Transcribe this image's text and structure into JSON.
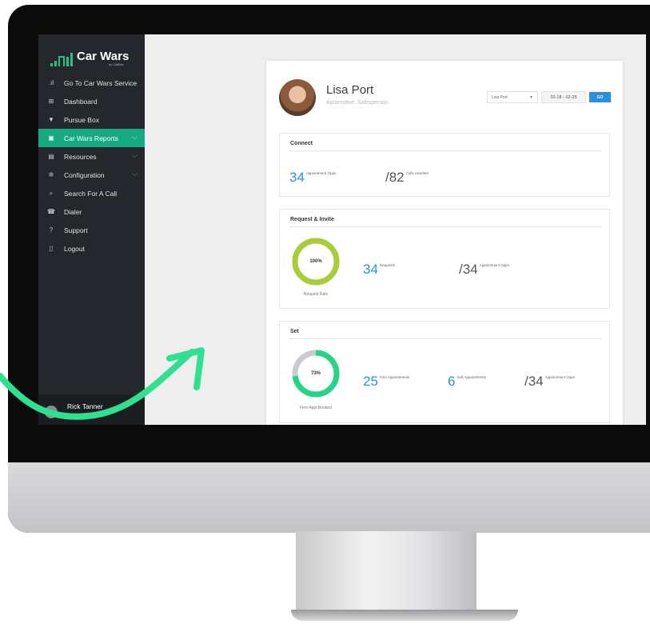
{
  "sidebar": {
    "brand_name": "Car Wars",
    "brand_sub": "by CallBox",
    "items": [
      {
        "label": "Go To Car Wars Service",
        "icon": "signal-bars-icon"
      },
      {
        "label": "Dashboard",
        "icon": "grid-icon"
      },
      {
        "label": "Pursue Box",
        "icon": "box-icon"
      },
      {
        "label": "Car Wars Reports",
        "icon": "report-icon",
        "active": true,
        "chevron": true
      },
      {
        "label": "Resources",
        "icon": "book-icon",
        "chevron": true
      },
      {
        "label": "Configuration",
        "icon": "gear-icon",
        "chevron": true
      },
      {
        "label": "Search For A Call",
        "icon": "search-icon"
      },
      {
        "label": "Dialer",
        "icon": "phone-icon"
      },
      {
        "label": "Support",
        "icon": "question-icon"
      },
      {
        "label": "Logout",
        "icon": "logout-icon"
      }
    ],
    "user_name": "Rick Tanner"
  },
  "header": {
    "name": "Lisa Port",
    "role": "Automotive: Salesperson",
    "select_value": "Lisa Port",
    "date_range": "02-18 - 02-25",
    "go_label": "GO"
  },
  "connect": {
    "title": "Connect",
    "appointment_opps": "34",
    "appointment_opps_label": "Appointment Opps",
    "calls_handled": "/82",
    "calls_handled_label": "Calls Handled"
  },
  "request": {
    "title": "Request & Invite",
    "rate_pct": "100%",
    "rate_value": 100,
    "rate_caption": "Request Rate",
    "requests": "34",
    "requests_label": "Requests",
    "appointment_opps": "/34",
    "appointment_opps_label": "Appointment Opps"
  },
  "set": {
    "title": "Set",
    "booked_pct": "73%",
    "booked_value": 73,
    "booked_caption": "Firm Appt Booked",
    "firm": "25",
    "firm_label": "Firm Appointments",
    "soft": "6",
    "soft_label": "Soft Appointments",
    "appointment_opps": "/34",
    "appointment_opps_label": "Appointment Opps"
  },
  "colors": {
    "accent_green": "#16a982",
    "ring_lime": "#a8cc3a",
    "ring_green": "#26d488",
    "number_blue": "#2a93d5",
    "sidebar_bg": "#24282c"
  }
}
